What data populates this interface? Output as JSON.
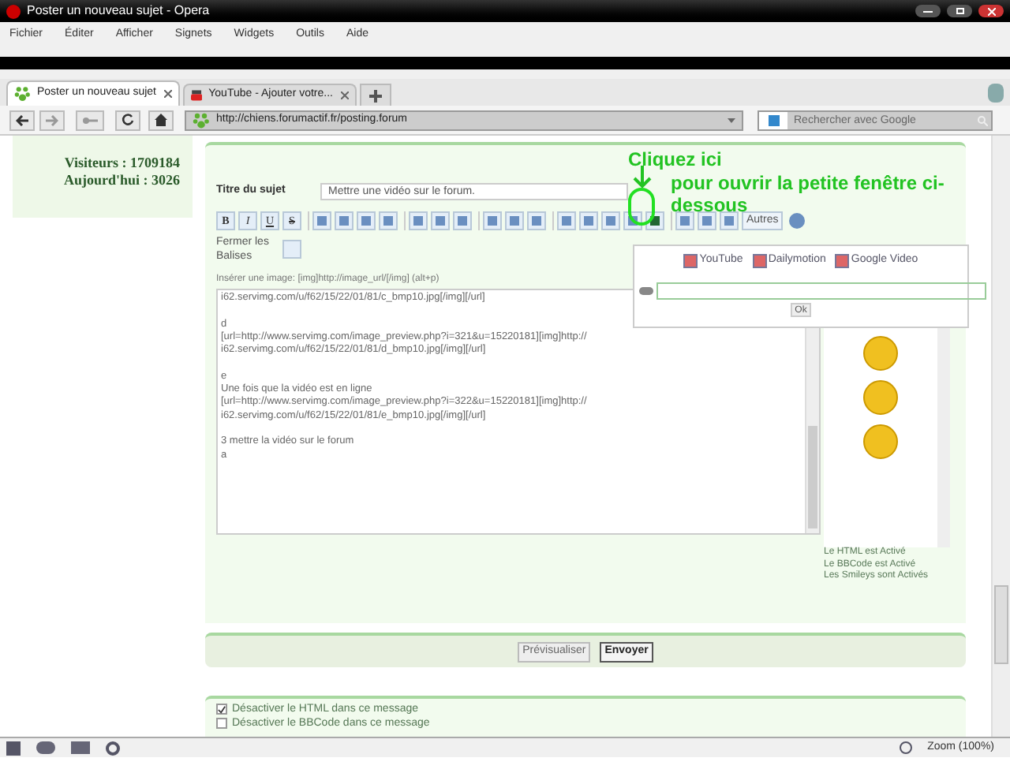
{
  "window": {
    "title": "Poster un nouveau sujet - Opera"
  },
  "menu": [
    "Fichier",
    "Éditer",
    "Afficher",
    "Signets",
    "Widgets",
    "Outils",
    "Aide"
  ],
  "tabs": [
    {
      "label": "Poster un nouveau sujet",
      "selected": true,
      "kind": "forum"
    },
    {
      "label": "YouTube - Ajouter votre...",
      "selected": false,
      "kind": "youtube"
    }
  ],
  "address_bar": {
    "url": "http://chiens.forumactif.fr/posting.forum"
  },
  "search": {
    "placeholder": "Rechercher avec Google"
  },
  "sidebar": {
    "lines": [
      "Visiteurs : 1709184",
      "Aujourd'hui : 3026"
    ]
  },
  "annotation": {
    "title": "Cliquez ici",
    "text": "pour ouvrir la petite fenêtre ci-dessous"
  },
  "form": {
    "title_label": "Titre du sujet",
    "title_value": "Mettre une vidéo sur le forum.",
    "format_buttons": [
      "B",
      "I",
      "U",
      "S"
    ],
    "others": "Autres",
    "close_tags": "Fermer les Balises",
    "hint": "Insérer une image: [img]http://image_url/[/img] (alt+p)",
    "message_blocks": [
      [
        "i62.servimg.com/u/f62/15/22/01/81/c_bmp10.jpg[/img][/url]"
      ],
      [
        "d",
        "[url=http://www.servimg.com/image_preview.php?i=321&u=15220181][img]http://",
        "i62.servimg.com/u/f62/15/22/01/81/d_bmp10.jpg[/img][/url]"
      ],
      [
        "e",
        "Une fois que la vidéo est en ligne",
        "[url=http://www.servimg.com/image_preview.php?i=322&u=15220181][img]http://",
        "i62.servimg.com/u/f62/15/22/01/81/e_bmp10.jpg[/img][/url]"
      ],
      [
        "3 mettre la vidéo sur le forum",
        "a"
      ]
    ],
    "status": [
      "Le HTML est Activé",
      "Le BBCode est Activé",
      "Les Smileys sont Activés"
    ]
  },
  "video_popup": {
    "sources": [
      "YouTube",
      "Dailymotion",
      "Google Video"
    ],
    "button": "Ok"
  },
  "actions": [
    {
      "label": "Prévisualiser",
      "primary": false
    },
    {
      "label": "Envoyer",
      "primary": true
    }
  ],
  "options": [
    {
      "label": "Désactiver le HTML dans ce message",
      "checked": true
    },
    {
      "label": "Désactiver le BBCode dans ce message",
      "checked": false
    }
  ],
  "status_bar": {
    "zoom": "Zoom (100%)"
  }
}
